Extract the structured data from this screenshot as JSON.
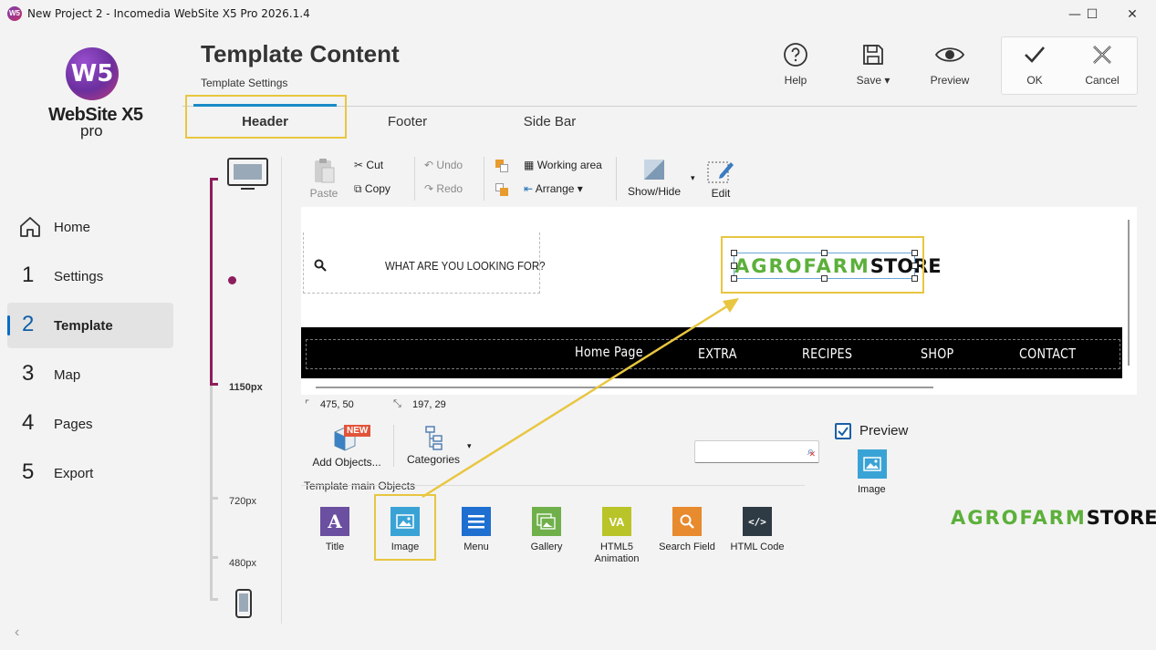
{
  "window": {
    "title": "New Project 2 - Incomedia WebSite X5 Pro 2026.1.4",
    "app_icon_text": "W5",
    "minimize": "—",
    "maximize": "☐",
    "close": "✕"
  },
  "brand": {
    "logo_text": "W5",
    "name_line1": "WebSite X5",
    "name_line2": "pro"
  },
  "nav": {
    "items": [
      {
        "num": "",
        "label": "Home"
      },
      {
        "num": "1",
        "label": "Settings"
      },
      {
        "num": "2",
        "label": "Template"
      },
      {
        "num": "3",
        "label": "Map"
      },
      {
        "num": "4",
        "label": "Pages"
      },
      {
        "num": "5",
        "label": "Export"
      }
    ],
    "collapse": "‹"
  },
  "header": {
    "title": "Template Content",
    "subtitle": "Template Settings",
    "buttons": {
      "help": "Help",
      "save": "Save",
      "preview": "Preview",
      "ok": "OK",
      "cancel": "Cancel"
    }
  },
  "tabs": [
    "Header",
    "Footer",
    "Side Bar"
  ],
  "ruler": {
    "labels": [
      "1150px",
      "720px",
      "480px"
    ]
  },
  "toolbar": {
    "paste": "Paste",
    "cut": "Cut",
    "copy": "Copy",
    "undo": "Undo",
    "redo": "Redo",
    "working_area": "Working area",
    "arrange": "Arrange",
    "show_hide": "Show/Hide",
    "edit": "Edit"
  },
  "canvas": {
    "search_text": "WHAT ARE YOU LOOKING FOR?",
    "logo_part1": "AGROFARM",
    "logo_part2": "STORE",
    "menu": [
      "Home Page",
      "EXTRA",
      "RECIPES",
      "SHOP",
      "CONTACT"
    ]
  },
  "status": {
    "position": "475, 50",
    "size": "197, 29"
  },
  "objects": {
    "add_objects": "Add Objects...",
    "new_badge": "NEW",
    "categories": "Categories",
    "section_label": "Template main Objects",
    "search_placeholder": "",
    "items": [
      {
        "label": "Title",
        "color": "#6b4fa0",
        "glyph": "A"
      },
      {
        "label": "Image",
        "color": "#3aa3d6",
        "glyph": "img"
      },
      {
        "label": "Menu",
        "color": "#1e6fd0",
        "glyph": "menu"
      },
      {
        "label": "Gallery",
        "color": "#6fb04a",
        "glyph": "gal"
      },
      {
        "label": "HTML5\nAnimation",
        "color": "#b9c428",
        "glyph": "VA"
      },
      {
        "label": "Search Field",
        "color": "#e88a2e",
        "glyph": "search"
      },
      {
        "label": "HTML Code",
        "color": "#2f3b44",
        "glyph": "</>"
      }
    ]
  },
  "preview_panel": {
    "checkbox_label": "Preview",
    "checked": true,
    "item_label": "Image",
    "logo_part1": "AGROFARM",
    "logo_part2": "STORE"
  },
  "colors": {
    "accent": "#1a8bc6",
    "highlight": "#e8c640",
    "ruler_active": "#8d1d5c",
    "logo_green": "#5cb03a"
  }
}
